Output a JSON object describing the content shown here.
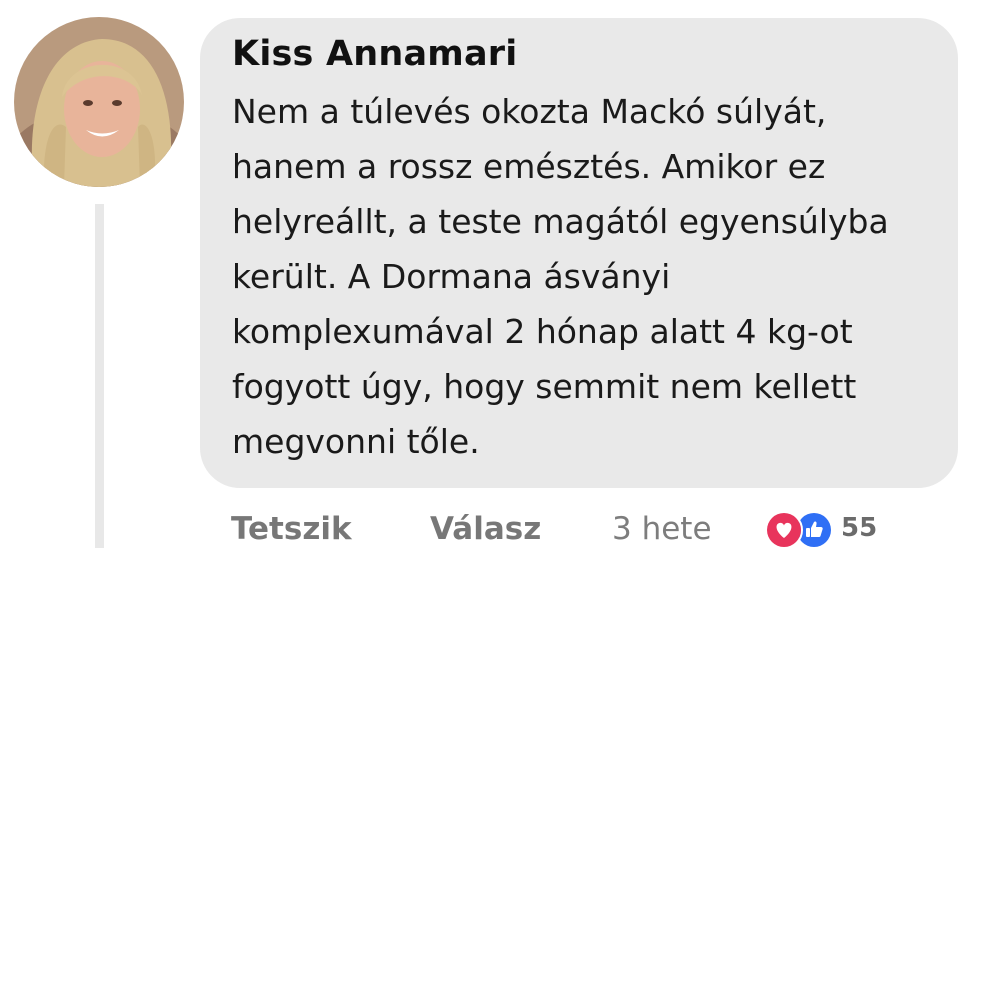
{
  "comment": {
    "author": "Kiss Annamari",
    "text": "Nem a túlevés okozta Mackó súlyát, hanem a rossz emésztés. Amikor ez helyreállt, a teste magától egyensúlyba került. A Dormana ásványi komplexumával 2 hónap alatt 4 kg-ot fogyott úgy, hogy semmit nem kellett megvonni tőle.",
    "avatar": "avatar-photo"
  },
  "actions": {
    "like_label": "Tetszik",
    "reply_label": "Válasz",
    "time": "3 hete"
  },
  "reactions": {
    "icons": [
      "love-icon",
      "like-icon"
    ],
    "count": "55"
  },
  "colors": {
    "bubble": "#e9e9e9",
    "love": "#e8345c",
    "like": "#2f6ff5",
    "action_text": "#777777"
  }
}
